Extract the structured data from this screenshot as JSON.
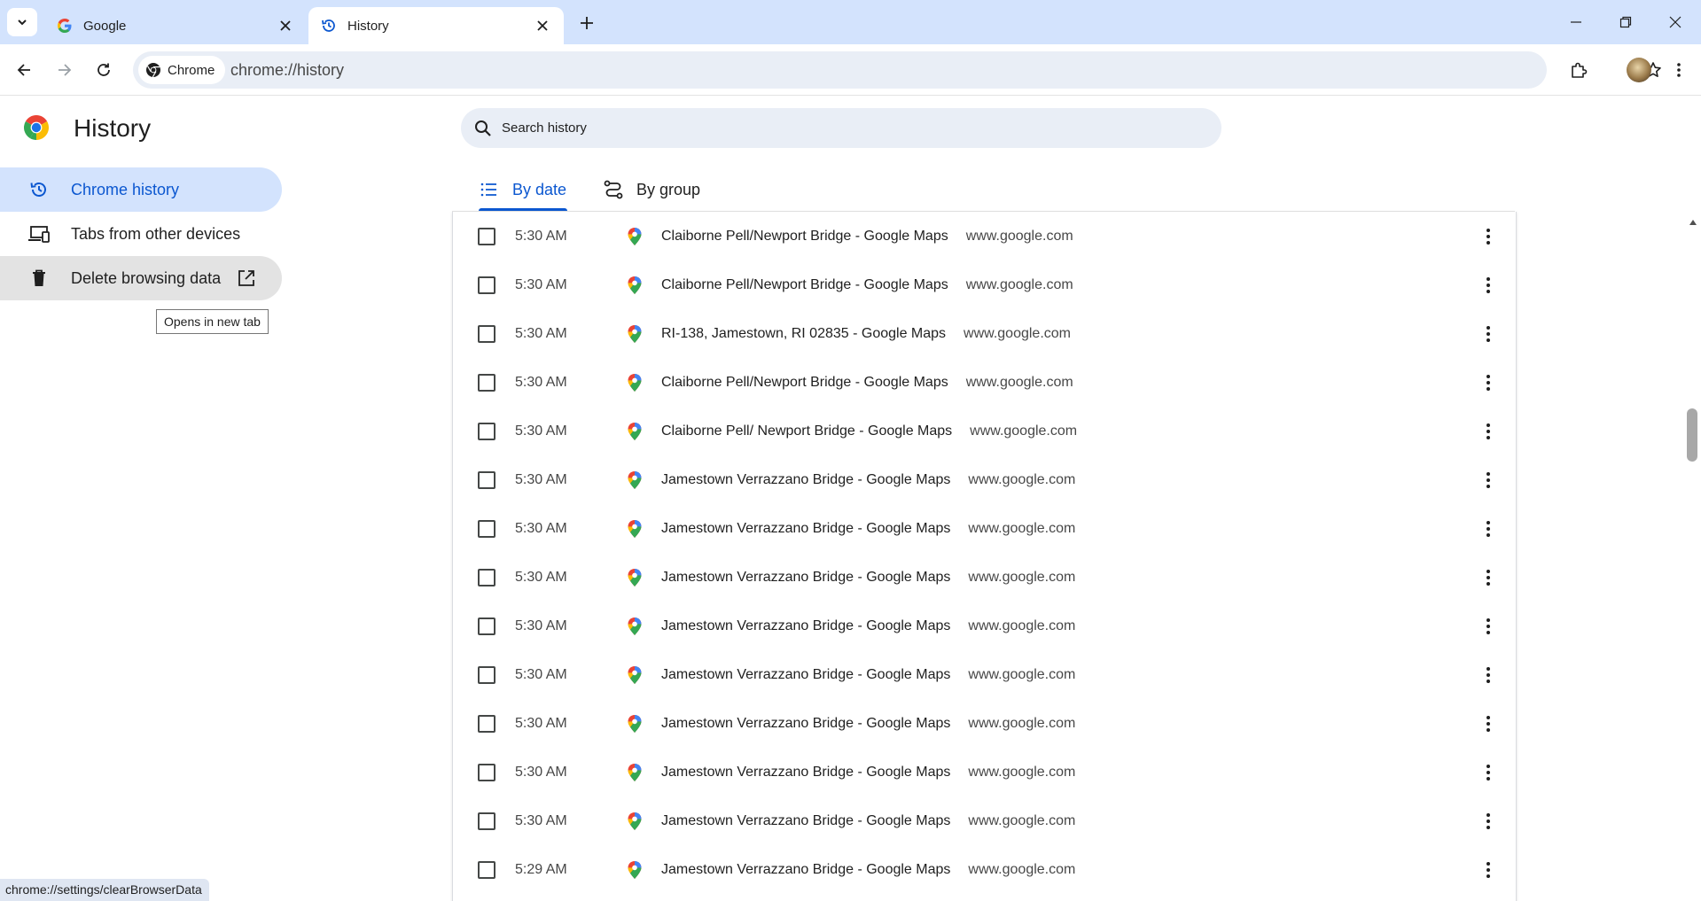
{
  "browser": {
    "tabs": [
      {
        "title": "Google",
        "active": false
      },
      {
        "title": "History",
        "active": true
      }
    ],
    "omnibox": {
      "chip_label": "Chrome",
      "url": "chrome://history"
    }
  },
  "sidebar": {
    "title": "History",
    "items": [
      {
        "label": "Chrome history",
        "icon": "history-icon",
        "selected": true
      },
      {
        "label": "Tabs from other devices",
        "icon": "devices-icon",
        "selected": false
      },
      {
        "label": "Delete browsing data",
        "icon": "trash-icon",
        "selected": false
      }
    ],
    "tooltip": "Opens in new tab"
  },
  "search": {
    "placeholder": "Search history"
  },
  "view_tabs": [
    {
      "label": "By date",
      "icon": "list-icon",
      "selected": true
    },
    {
      "label": "By group",
      "icon": "route-icon",
      "selected": false
    }
  ],
  "history_rows": [
    {
      "time": "5:30 AM",
      "title": "Claiborne Pell/Newport Bridge - Google Maps",
      "domain": "www.google.com"
    },
    {
      "time": "5:30 AM",
      "title": "Claiborne Pell/Newport Bridge - Google Maps",
      "domain": "www.google.com"
    },
    {
      "time": "5:30 AM",
      "title": "RI-138, Jamestown, RI 02835 - Google Maps",
      "domain": "www.google.com"
    },
    {
      "time": "5:30 AM",
      "title": "Claiborne Pell/Newport Bridge - Google Maps",
      "domain": "www.google.com"
    },
    {
      "time": "5:30 AM",
      "title": "Claiborne Pell/ Newport Bridge - Google Maps",
      "domain": "www.google.com"
    },
    {
      "time": "5:30 AM",
      "title": "Jamestown Verrazzano Bridge - Google Maps",
      "domain": "www.google.com"
    },
    {
      "time": "5:30 AM",
      "title": "Jamestown Verrazzano Bridge - Google Maps",
      "domain": "www.google.com"
    },
    {
      "time": "5:30 AM",
      "title": "Jamestown Verrazzano Bridge - Google Maps",
      "domain": "www.google.com"
    },
    {
      "time": "5:30 AM",
      "title": "Jamestown Verrazzano Bridge - Google Maps",
      "domain": "www.google.com"
    },
    {
      "time": "5:30 AM",
      "title": "Jamestown Verrazzano Bridge - Google Maps",
      "domain": "www.google.com"
    },
    {
      "time": "5:30 AM",
      "title": "Jamestown Verrazzano Bridge - Google Maps",
      "domain": "www.google.com"
    },
    {
      "time": "5:30 AM",
      "title": "Jamestown Verrazzano Bridge - Google Maps",
      "domain": "www.google.com"
    },
    {
      "time": "5:30 AM",
      "title": "Jamestown Verrazzano Bridge - Google Maps",
      "domain": "www.google.com"
    },
    {
      "time": "5:29 AM",
      "title": "Jamestown Verrazzano Bridge - Google Maps",
      "domain": "www.google.com"
    }
  ],
  "status_bar": {
    "link_preview": "chrome://settings/clearBrowserData"
  },
  "colors": {
    "accent": "#0b57d0",
    "tabstrip": "#d3e3fd",
    "selected_nav": "#d3e3fd"
  }
}
